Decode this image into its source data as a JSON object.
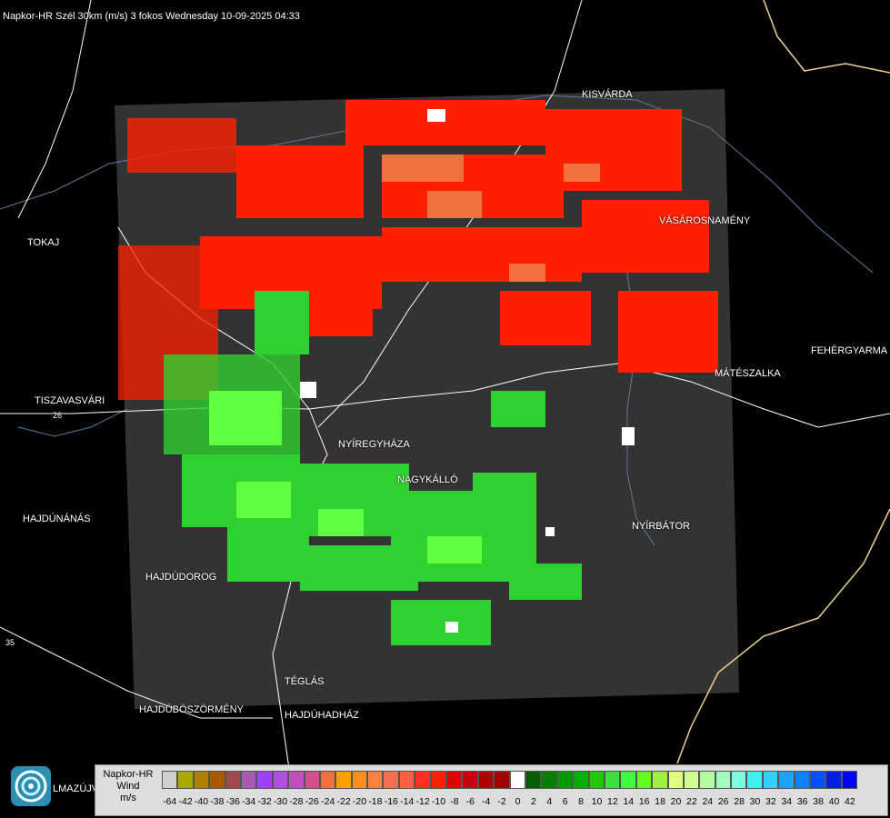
{
  "title": "Napkor-HR Szél 30km (m/s) 3 fokos Wednesday 10-09-2025 04:33",
  "places": [
    {
      "name": "KISVÁRDA"
    },
    {
      "name": "TOKAJ"
    },
    {
      "name": "VÁSÁROSNAMÉNY"
    },
    {
      "name": "FEHÉRGYARMA"
    },
    {
      "name": "MÁTÉSZALKA"
    },
    {
      "name": "TISZAVASVÁRI"
    },
    {
      "name": "NYÍREGYHÁZA"
    },
    {
      "name": "NAGYKÁLLÓ"
    },
    {
      "name": "HAJDÚNÁNÁS"
    },
    {
      "name": "NYÍRBÁTOR"
    },
    {
      "name": "HAJDÚDOROG"
    },
    {
      "name": "TÉGLÁS"
    },
    {
      "name": "HAJDÚBÖSZÖRMÉNY"
    },
    {
      "name": "HAJDÚHADHÁZ"
    },
    {
      "name": "LMAZÚJVÁR"
    }
  ],
  "road_numbers": [
    "26",
    "35"
  ],
  "legend": {
    "line1": "Napkor-HR",
    "line2": "Wind",
    "line3": "m/s",
    "ticks": [
      "-64",
      "-42",
      "-40",
      "-38",
      "-36",
      "-34",
      "-32",
      "-30",
      "-28",
      "-26",
      "-24",
      "-22",
      "-20",
      "-18",
      "-16",
      "-14",
      "-12",
      "-10",
      "-8",
      "-6",
      "-4",
      "-2",
      "0",
      "2",
      "4",
      "6",
      "8",
      "10",
      "12",
      "14",
      "16",
      "18",
      "20",
      "22",
      "24",
      "26",
      "28",
      "30",
      "32",
      "34",
      "36",
      "38",
      "40",
      "42"
    ],
    "colors": [
      "#d0d0d0",
      "#a8a800",
      "#b08000",
      "#a85a00",
      "#a04850",
      "#a85ab0",
      "#a040ff",
      "#b050e0",
      "#c050c0",
      "#d05090",
      "#f07040",
      "#ffa000",
      "#ff9020",
      "#ff8040",
      "#f07050",
      "#ff6040",
      "#ff3020",
      "#ff2000",
      "#e00000",
      "#c80010",
      "#b00000",
      "#a00000",
      "#ffffff",
      "#006000",
      "#008000",
      "#009800",
      "#00b000",
      "#20c800",
      "#40e040",
      "#40ff40",
      "#60ff20",
      "#a0f040",
      "#e0ff80",
      "#d0ff90",
      "#b0ffa0",
      "#a0ffc0",
      "#80ffe0",
      "#40f0f0",
      "#30d0ff",
      "#20a0ff",
      "#1080ff",
      "#0050ff",
      "#0020e0",
      "#0000ff"
    ]
  },
  "colors": {
    "background": "#000000",
    "radar_area": "#333333",
    "border": "#f0d090",
    "rivers": "#5a7aa0",
    "roads": "#ffffff"
  }
}
